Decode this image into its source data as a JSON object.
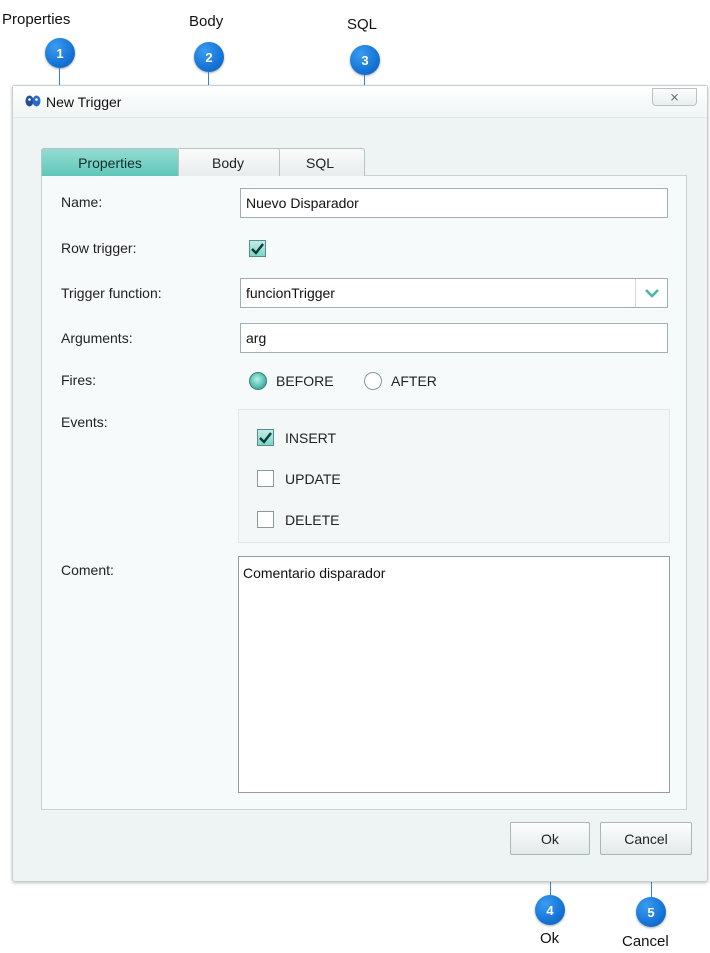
{
  "callouts": [
    {
      "number": "1",
      "label": "Properties"
    },
    {
      "number": "2",
      "label": "Body"
    },
    {
      "number": "3",
      "label": "SQL"
    },
    {
      "number": "4",
      "label": "Ok"
    },
    {
      "number": "5",
      "label": "Cancel"
    }
  ],
  "window": {
    "title": "New Trigger",
    "close_glyph": "⨯"
  },
  "tabs": [
    {
      "label": "Properties",
      "active": true
    },
    {
      "label": "Body",
      "active": false
    },
    {
      "label": "SQL",
      "active": false
    }
  ],
  "form": {
    "name": {
      "label": "Name:",
      "value": "Nuevo Disparador"
    },
    "row_trigger": {
      "label": "Row trigger:",
      "checked": true
    },
    "trigger_function": {
      "label": "Trigger function:",
      "value": "funcionTrigger"
    },
    "arguments": {
      "label": "Arguments:",
      "value": "arg"
    },
    "fires": {
      "label": "Fires:",
      "options": [
        {
          "label": "BEFORE",
          "selected": true
        },
        {
          "label": "AFTER",
          "selected": false
        }
      ]
    },
    "events": {
      "label": "Events:",
      "options": [
        {
          "label": "INSERT",
          "checked": true
        },
        {
          "label": "UPDATE",
          "checked": false
        },
        {
          "label": "DELETE",
          "checked": false
        }
      ]
    },
    "comment": {
      "label": "Coment:",
      "value": "Comentario disparador"
    }
  },
  "buttons": {
    "ok": "Ok",
    "cancel": "Cancel"
  },
  "colors": {
    "accent_teal": "#5fc6b8",
    "callout_blue": "#1574d6"
  },
  "icons": {
    "app": "database-app-icon",
    "close": "close-icon",
    "dropdown": "chevron-down-icon",
    "checkmark": "checkmark-icon"
  }
}
